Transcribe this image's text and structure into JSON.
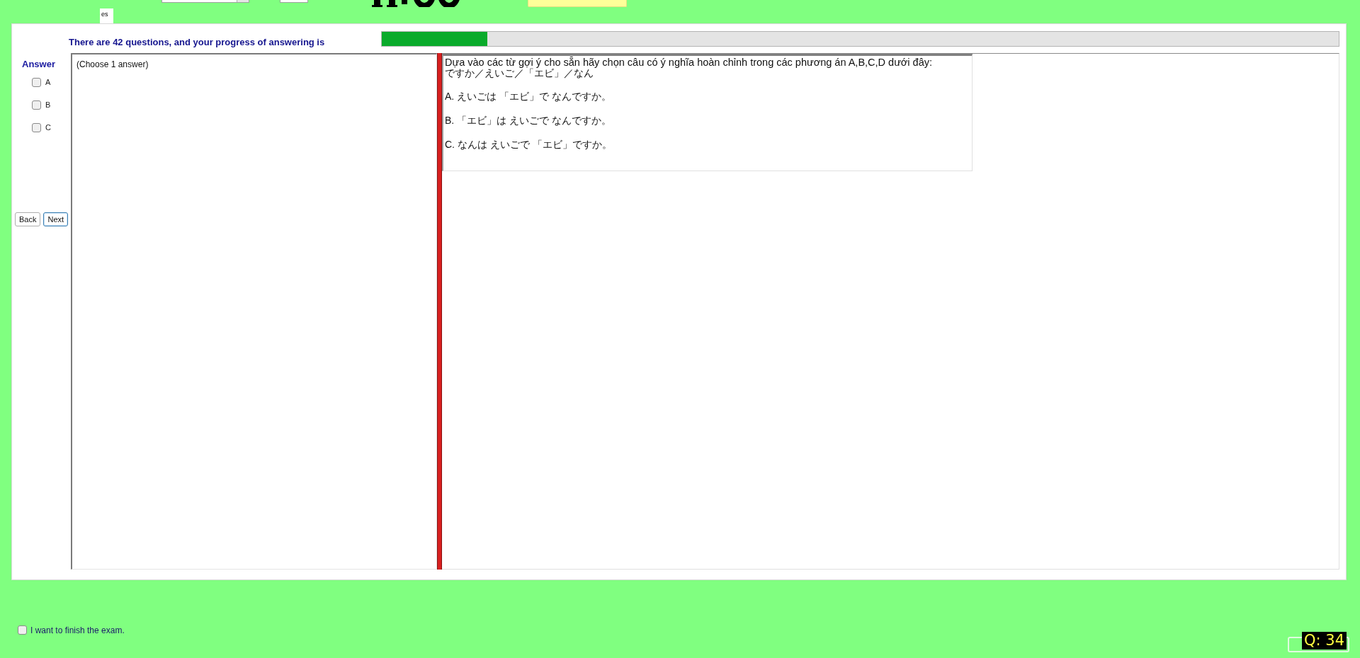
{
  "top_bar": {
    "tab_label": "es"
  },
  "progress": {
    "label": "There are 42 questions, and your progress of answering is",
    "level": 0.11
  },
  "answer_panel": {
    "title": "Answer",
    "options": [
      {
        "label": "A",
        "checked": false
      },
      {
        "label": "B",
        "checked": false
      },
      {
        "label": "C",
        "checked": false
      }
    ],
    "buttons": [
      {
        "label": "Back",
        "focused": false
      },
      {
        "label": "Next",
        "focused": true
      }
    ]
  },
  "instruction": "(Choose 1 answer)",
  "question": {
    "prompt": "Dựa vào các từ gợi ý cho sẵn hãy chọn câu có ý nghĩa hoàn chỉnh trong các phương án A,B,C,D dưới đây:",
    "words": "ですか／えいご／「エビ」／なん",
    "options": [
      "A. えいごは 「エビ」で なんですか。",
      "B. 「エビ」は えいごで なんですか。",
      "C. なんは えいごで 「エビ」ですか。"
    ]
  },
  "finish": {
    "label": "I want to finish the exam.",
    "checked": false
  },
  "question_counter": "Q: 34"
}
